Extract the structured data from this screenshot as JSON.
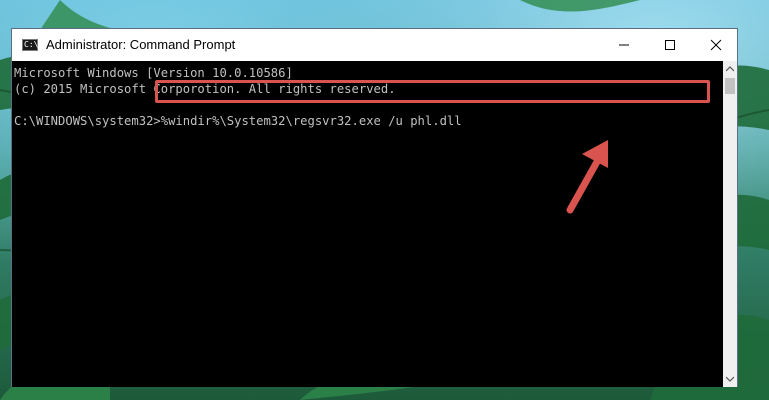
{
  "window": {
    "title": "Administrator: Command Prompt",
    "icon": "cmd-icon",
    "icon_label": "C:\\"
  },
  "console": {
    "line1": "Microsoft Windows [Version 10.0.10586]",
    "line2": "(c) 2015 Microsoft Corporotion. All rights reserved.",
    "prompt": "C:\\WINDOWS\\system32>",
    "command": "%windir%\\System32\\regsvr32.exe /u phl.dll"
  },
  "colors": {
    "highlight": "#d9534f",
    "console_bg": "#000000",
    "console_text": "#c0c0c0"
  }
}
